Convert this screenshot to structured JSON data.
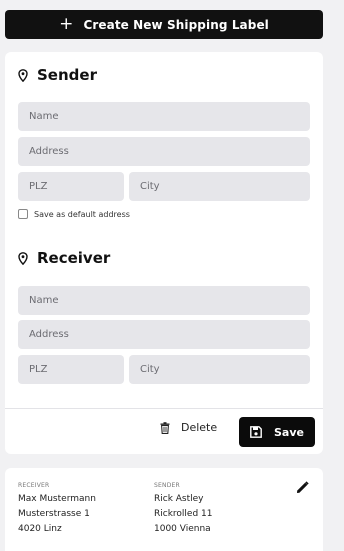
{
  "header": {
    "create_label": "Create New Shipping Label"
  },
  "sender": {
    "title": "Sender",
    "name_placeholder": "Name",
    "address_placeholder": "Address",
    "plz_placeholder": "PLZ",
    "city_placeholder": "City",
    "default_checkbox_label": "Save as default address"
  },
  "receiver": {
    "title": "Receiver",
    "name_placeholder": "Name",
    "address_placeholder": "Address",
    "plz_placeholder": "PLZ",
    "city_placeholder": "City"
  },
  "actions": {
    "delete_label": "Delete",
    "save_label": "Save"
  },
  "label_entry": {
    "receiver_caption": "RECEIVER",
    "receiver_name": "Max Mustermann",
    "receiver_street": "Musterstrasse 1",
    "receiver_city": "4020 Linz",
    "sender_caption": "SENDER",
    "sender_name": "Rick Astley",
    "sender_street": "Rickrolled 11",
    "sender_city": "1000 Vienna"
  },
  "icons": {
    "create": "plus-icon",
    "section": "map-pin-icon",
    "delete": "trash-icon",
    "save": "floppy-disk-icon",
    "edit": "pencil-icon"
  },
  "colors": {
    "primary": "#111111",
    "field_bg": "#e6e6ea",
    "page_bg": "#f1f1f3"
  }
}
